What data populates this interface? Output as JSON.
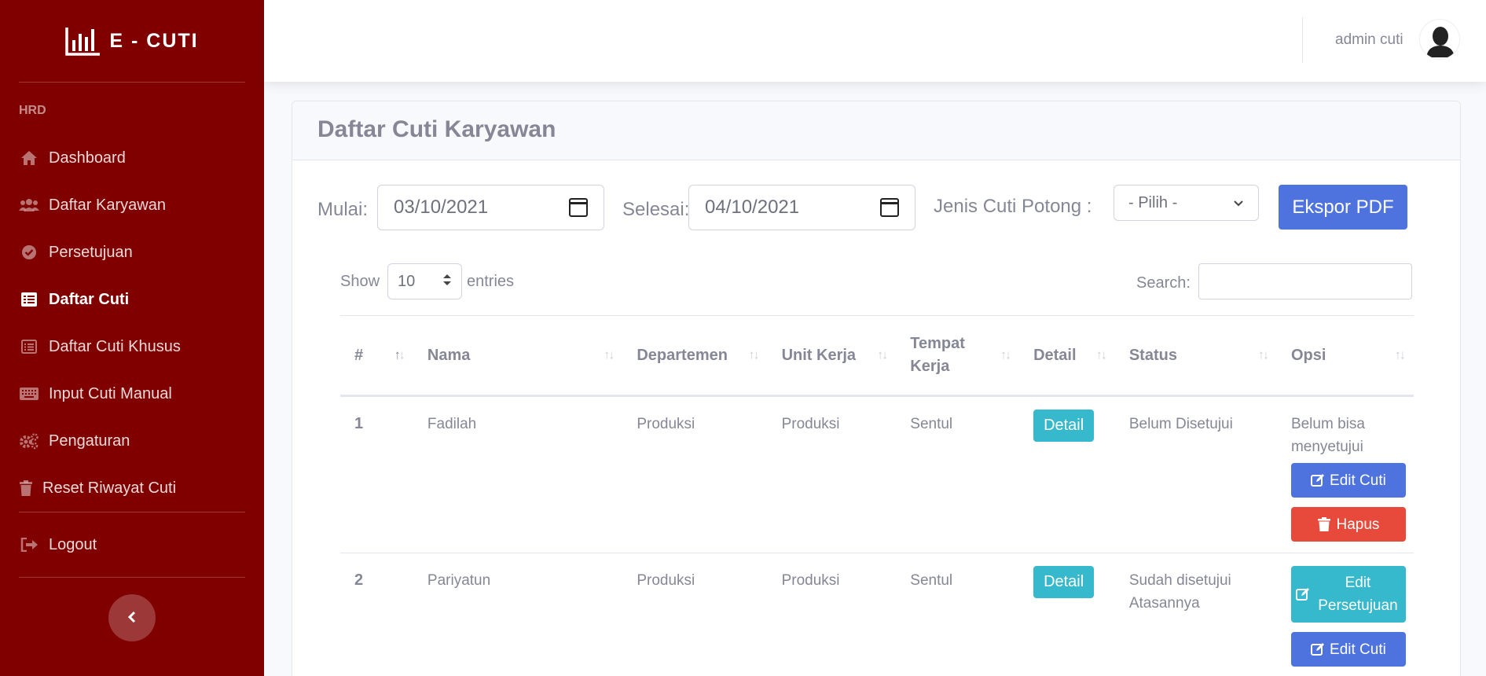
{
  "sidebar": {
    "brand": "E - CUTI",
    "heading": "HRD",
    "items": [
      {
        "label": "Dashboard",
        "icon": "home-icon"
      },
      {
        "label": "Daftar Karyawan",
        "icon": "users-icon"
      },
      {
        "label": "Persetujuan",
        "icon": "check-circle-icon"
      },
      {
        "label": "Daftar Cuti",
        "icon": "list-icon",
        "active": true
      },
      {
        "label": "Daftar Cuti Khusus",
        "icon": "list-alt-icon"
      },
      {
        "label": "Input Cuti Manual",
        "icon": "keyboard-icon"
      },
      {
        "label": "Pengaturan",
        "icon": "cogs-icon"
      },
      {
        "label": "Reset Riwayat Cuti",
        "icon": "trash-icon"
      }
    ],
    "logout": "Logout",
    "toggle_icon": "chevron-left-icon"
  },
  "topbar": {
    "user_name": "admin cuti"
  },
  "page": {
    "title": "Daftar Cuti Karyawan",
    "filters": {
      "start_label": "Mulai:",
      "start_value": "03/10/2021",
      "end_label": "Selesai:",
      "end_value": "04/10/2021",
      "type_label": "Jenis Cuti Potong :",
      "type_value": "- Pilih -",
      "export_label": "Ekspor PDF"
    },
    "datatable": {
      "show_label": "Show",
      "length_value": "10",
      "entries_label": "entries",
      "search_label": "Search:",
      "search_value": "",
      "columns": [
        "#",
        "Nama",
        "Departemen",
        "Unit Kerja",
        "Tempat Kerja",
        "Detail",
        "Status",
        "Opsi"
      ],
      "rows": [
        {
          "no": "1",
          "nama": "Fadilah",
          "departemen": "Produksi",
          "unit": "Produksi",
          "tempat": "Sentul",
          "detail": "Detail",
          "status": "Belum Disetujui",
          "opsi_text": "Belum bisa menyetujui",
          "edit_label": "Edit Cuti",
          "hapus_label": "Hapus"
        },
        {
          "no": "2",
          "nama": "Pariyatun",
          "departemen": "Produksi",
          "unit": "Produksi",
          "tempat": "Sentul",
          "detail": "Detail",
          "status": "Sudah disetujui Atasannya",
          "edit_persetujuan_label": "Edit Persetujuan",
          "edit_label": "Edit Cuti"
        }
      ]
    }
  },
  "colors": {
    "sidebar": "#800000",
    "primary": "#4e73df",
    "info": "#36b9cc",
    "danger": "#e74a3b",
    "text": "#858796"
  }
}
